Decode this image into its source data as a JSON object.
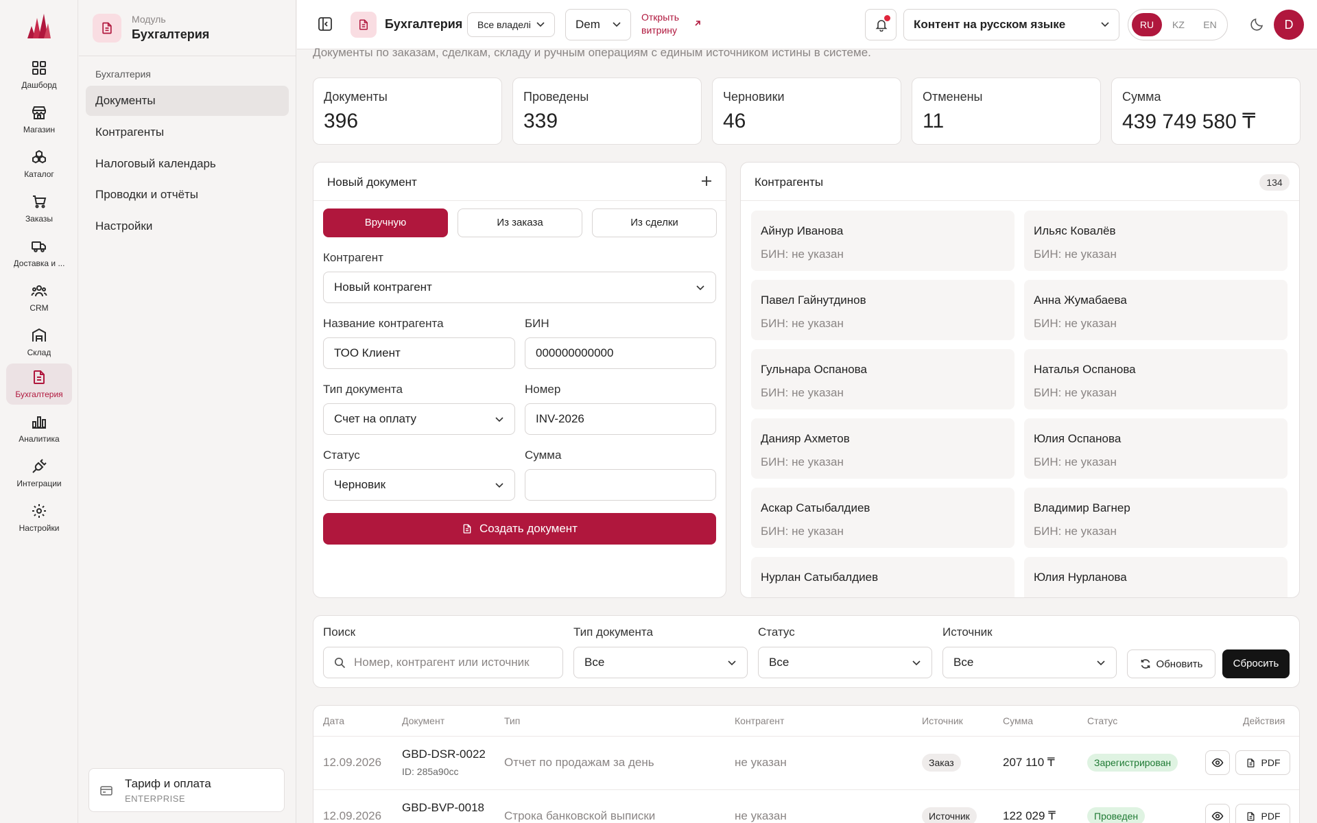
{
  "rail": {
    "items": [
      {
        "label": "Дашборд",
        "icon": "dashboard-icon"
      },
      {
        "label": "Магазин",
        "icon": "store-icon"
      },
      {
        "label": "Каталог",
        "icon": "catalog-icon"
      },
      {
        "label": "Заказы",
        "icon": "cart-icon"
      },
      {
        "label": "Доставка и ...",
        "icon": "truck-icon"
      },
      {
        "label": "CRM",
        "icon": "users-icon"
      },
      {
        "label": "Склад",
        "icon": "warehouse-icon"
      },
      {
        "label": "Бухгалтерия",
        "icon": "document-icon",
        "active": true
      },
      {
        "label": "Аналитика",
        "icon": "bar-chart-icon"
      },
      {
        "label": "Интеграции",
        "icon": "plug-icon"
      },
      {
        "label": "Настройки",
        "icon": "gear-icon"
      }
    ]
  },
  "sidebar": {
    "module_caption": "Модуль",
    "module_title": "Бухгалтерия",
    "section": "Бухгалтерия",
    "items": [
      {
        "label": "Документы",
        "active": true
      },
      {
        "label": "Контрагенты"
      },
      {
        "label": "Налоговый календарь"
      },
      {
        "label": "Проводки и отчёты"
      },
      {
        "label": "Настройки"
      }
    ],
    "plan_title": "Тариф и оплата",
    "plan_tier": "ENTERPRISE"
  },
  "topbar": {
    "title": "Бухгалтерия",
    "owners_select": "Все владелі",
    "store_select": "Dem",
    "storefront_link": "Открыть витрину",
    "content_lang_select": "Контент на русском языке",
    "langs": [
      "RU",
      "KZ",
      "EN"
    ],
    "active_lang": "RU",
    "avatar_initial": "D"
  },
  "page": {
    "description": "Документы по заказам, сделкам, складу и ручным операциям с единым источником истины в системе."
  },
  "stats": [
    {
      "label": "Документы",
      "value": "396"
    },
    {
      "label": "Проведены",
      "value": "339"
    },
    {
      "label": "Черновики",
      "value": "46"
    },
    {
      "label": "Отменены",
      "value": "11"
    },
    {
      "label": "Сумма",
      "value": "439 749 580 ₸"
    }
  ],
  "new_doc": {
    "title": "Новый документ",
    "modes": [
      "Вручную",
      "Из заказа",
      "Из сделки"
    ],
    "active_mode": "Вручную",
    "counterparty_label": "Контрагент",
    "counterparty_value": "Новый контрагент",
    "name_label": "Название контрагента",
    "name_value": "ТОО Клиент",
    "bin_label": "БИН",
    "bin_value": "000000000000",
    "doctype_label": "Тип документа",
    "doctype_value": "Счет на оплату",
    "number_label": "Номер",
    "number_value": "INV-2026",
    "status_label": "Статус",
    "status_value": "Черновик",
    "sum_label": "Сумма",
    "sum_value": "",
    "create_button": "Создать документ"
  },
  "counterparties": {
    "title": "Контрагенты",
    "count": "134",
    "items": [
      {
        "name": "Айнур Иванова",
        "bin": "БИН: не указан"
      },
      {
        "name": "Ильяс Ковалёв",
        "bin": "БИН: не указан"
      },
      {
        "name": "Павел Гайнутдинов",
        "bin": "БИН: не указан"
      },
      {
        "name": "Анна Жумабаева",
        "bin": "БИН: не указан"
      },
      {
        "name": "Гульнара Оспанова",
        "bin": "БИН: не указан"
      },
      {
        "name": "Наталья Оспанова",
        "bin": "БИН: не указан"
      },
      {
        "name": "Данияр Ахметов",
        "bin": "БИН: не указан"
      },
      {
        "name": "Юлия Оспанова",
        "bin": "БИН: не указан"
      },
      {
        "name": "Аскар Сатыбалдиев",
        "bin": "БИН: не указан"
      },
      {
        "name": "Владимир Вагнер",
        "bin": "БИН: не указан"
      },
      {
        "name": "Нурлан Сатыбалдиев",
        "bin": ""
      },
      {
        "name": "Юлия Нурланова",
        "bin": ""
      }
    ]
  },
  "filters": {
    "search_label": "Поиск",
    "search_placeholder": "Номер, контрагент или источник",
    "doctype_label": "Тип документа",
    "doctype_value": "Все",
    "status_label": "Статус",
    "status_value": "Все",
    "source_label": "Источник",
    "source_value": "Все",
    "refresh_button": "Обновить",
    "reset_button": "Сбросить"
  },
  "table": {
    "columns": [
      "Дата",
      "Документ",
      "Тип",
      "Контрагент",
      "Источник",
      "Сумма",
      "Статус",
      "Действия"
    ],
    "rows": [
      {
        "date": "12.09.2026",
        "doc": "GBD-DSR-0022",
        "id": "ID: 285a90cc",
        "type": "Отчет по продажам за день",
        "counterparty": "не указан",
        "source": "Заказ",
        "sum": "207 110 ₸",
        "status": "Зарегистрирован",
        "pdf": "PDF"
      },
      {
        "date": "12.09.2026",
        "doc": "GBD-BVP-0018",
        "id": "",
        "type": "Строка банковской выписки",
        "counterparty": "не указан",
        "source": "Источник",
        "sum": "122 029 ₸",
        "status": "Проведен",
        "pdf": "PDF"
      }
    ]
  },
  "colors": {
    "brand": "#b0173d",
    "success_bg": "#dff3e2",
    "success_text": "#1f7a34"
  }
}
